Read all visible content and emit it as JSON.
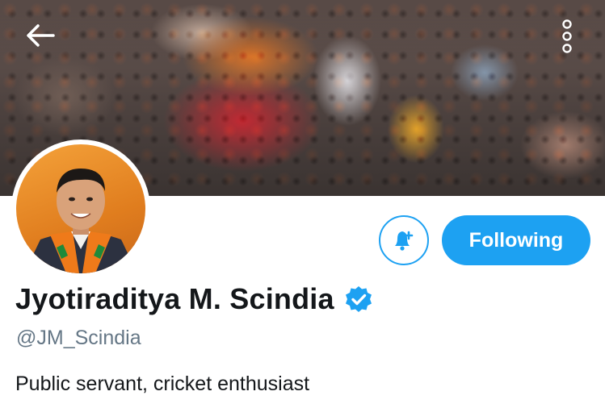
{
  "header": {
    "back_icon": "arrow-left-icon",
    "more_icon": "vertical-ellipsis-icon"
  },
  "profile": {
    "display_name": "Jyotiraditya M. Scindia",
    "verified": true,
    "handle": "@JM_Scindia",
    "bio": "Public servant, cricket enthusiast"
  },
  "actions": {
    "notify_icon": "bell-plus-icon",
    "following_label": "Following"
  },
  "colors": {
    "accent": "#1da1f2",
    "text_primary": "#14171a",
    "text_secondary": "#657786"
  }
}
